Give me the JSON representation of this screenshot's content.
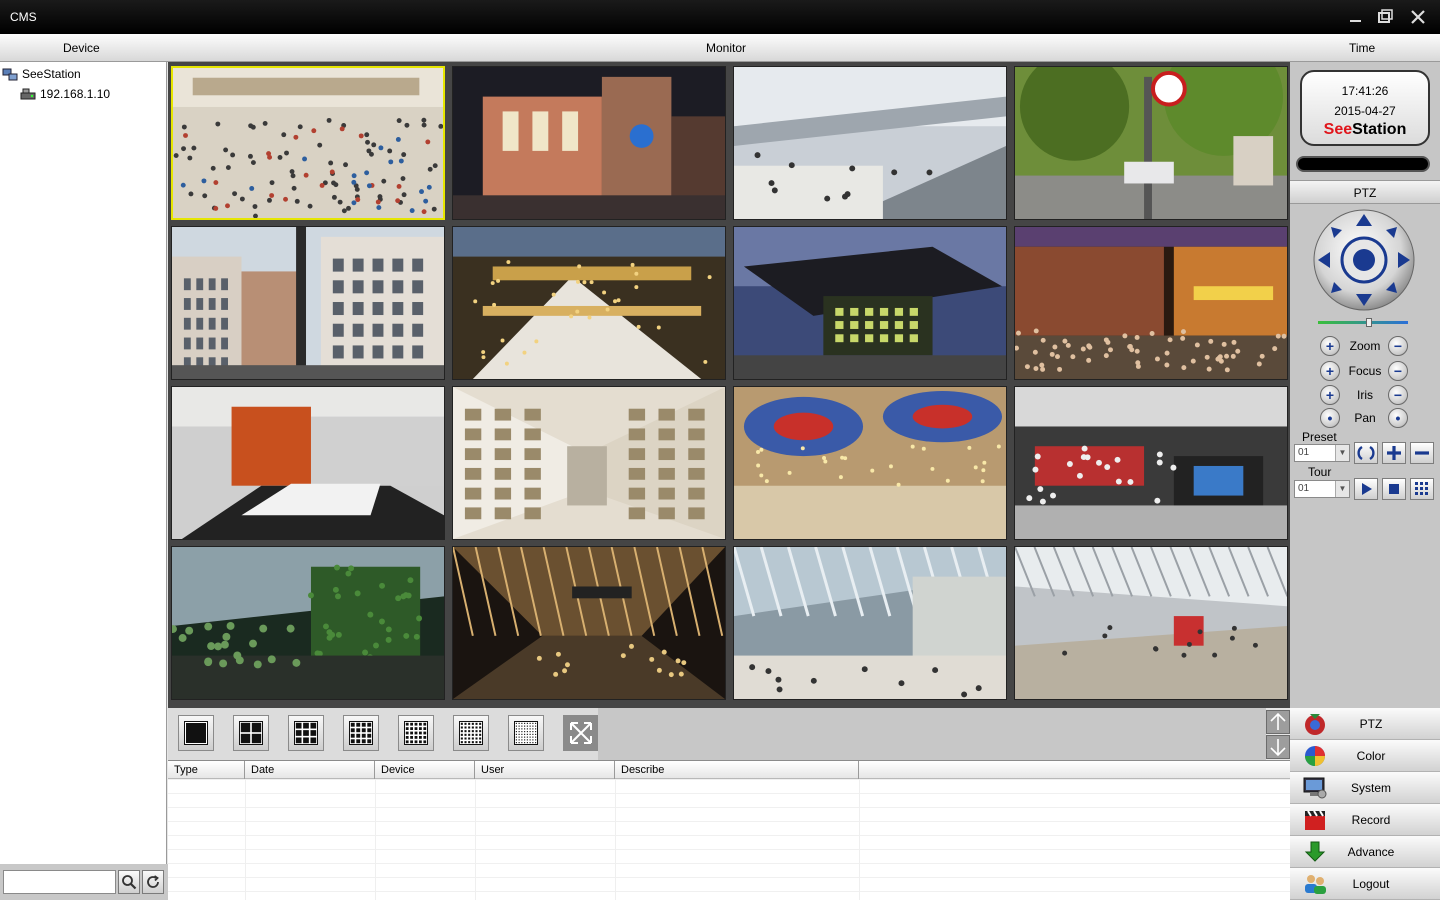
{
  "window": {
    "title": "CMS"
  },
  "header": {
    "device": "Device",
    "monitor": "Monitor",
    "time": "Time"
  },
  "device_tree": {
    "root": "SeeStation",
    "child": "192.168.1.10"
  },
  "search": {
    "value": ""
  },
  "cameras": [
    {
      "scene": "mall-crowd"
    },
    {
      "scene": "night-building"
    },
    {
      "scene": "airport-walkway"
    },
    {
      "scene": "street-trees"
    },
    {
      "scene": "old-town-street"
    },
    {
      "scene": "mall-atrium"
    },
    {
      "scene": "modern-building-dusk"
    },
    {
      "scene": "casino-street"
    },
    {
      "scene": "meeting-room"
    },
    {
      "scene": "mall-interior"
    },
    {
      "scene": "ornate-hall"
    },
    {
      "scene": "store-interior"
    },
    {
      "scene": "green-atrium"
    },
    {
      "scene": "airport-terminal-night"
    },
    {
      "scene": "airport-hall"
    },
    {
      "scene": "terminal-concourse"
    }
  ],
  "log": {
    "columns": [
      "Type",
      "Date",
      "Device",
      "User",
      "Describe"
    ]
  },
  "clock": {
    "time": "17:41:26",
    "date": "2015-04-27",
    "brand_red": "See",
    "brand_black": "Station"
  },
  "ptz": {
    "title": "PTZ",
    "rows": [
      "Zoom",
      "Focus",
      "Iris",
      "Pan"
    ],
    "preset_label": "Preset",
    "preset_value": "01",
    "tour_label": "Tour",
    "tour_value": "01"
  },
  "menu": [
    "PTZ",
    "Color",
    "System",
    "Record",
    "Advance",
    "Logout"
  ],
  "colors": {
    "accent": "#e0151b",
    "active_border": "#e6e600",
    "ptz_blue": "#1a3a90"
  }
}
